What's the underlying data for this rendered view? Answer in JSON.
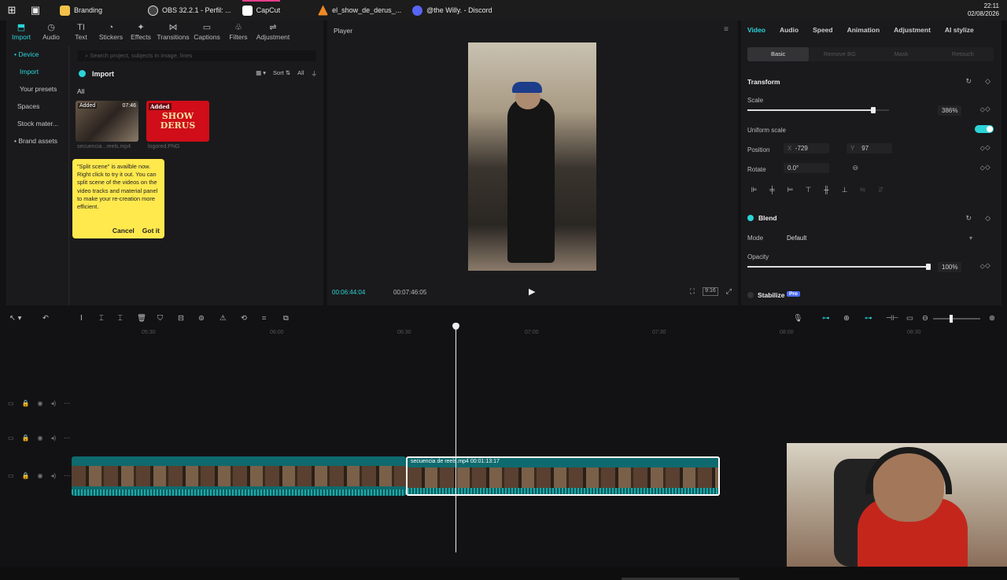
{
  "taskbar": {
    "tasks": [
      {
        "label": "Branding",
        "color": "#f2c14b"
      },
      {
        "label": "OBS 32.2.1 - Perfil: ...",
        "color": "#444444"
      },
      {
        "label": "CapCut",
        "color": "#ffffff"
      },
      {
        "label": "el_show_de_derus_...",
        "color": "#f08a24"
      },
      {
        "label": "@the Willy. - Discord",
        "color": "#5865f2"
      }
    ],
    "time": "22:11",
    "date": "02/08/2026"
  },
  "toolbar": {
    "import": "Import",
    "audio": "Audio",
    "text": "Text",
    "stickers": "Stickers",
    "effects": "Effects",
    "transitions": "Transitions",
    "captions": "Captions",
    "filters": "Filters",
    "adjustment": "Adjustment"
  },
  "sidenav": {
    "device": "• Device",
    "import": "Import",
    "presets": "Your presets",
    "spaces": "Spaces",
    "stock": "Stock mater...",
    "brand": "• Brand assets"
  },
  "media": {
    "search_placeholder": "Search project, subjects in image, lines",
    "import_label": "Import",
    "sort": "Sort",
    "all_filter": "All",
    "all_label": "All",
    "items": [
      {
        "tag": "Added",
        "duration": "07:46",
        "name": "secuencia...reels.mp4"
      },
      {
        "tag": "Added",
        "duration": "",
        "name": "logored.PNG",
        "art": "SHOW DERUS"
      }
    ]
  },
  "tooltip": {
    "text": "\"Split scene\" is availble now. Right click to try it out. You can split scene of the videos on the video tracks and material panel to make your re-creation more efficient.",
    "cancel": "Cancel",
    "ok": "Got it"
  },
  "player": {
    "title": "Player",
    "current_time": "00:06:44:04",
    "total_time": "00:07:46:05",
    "ratio": "9:16"
  },
  "props": {
    "tabs": [
      "Video",
      "Audio",
      "Speed",
      "Animation",
      "Adjustment",
      "AI stylize"
    ],
    "subtabs": [
      "Basic",
      "Remove BG",
      "Mask",
      "Retouch"
    ],
    "transform": "Transform",
    "scale_label": "Scale",
    "scale_value": "386%",
    "scale_level": 0.89,
    "uniform_label": "Uniform scale",
    "position_label": "Position",
    "pos_x_prefix": "X",
    "pos_x": "-729",
    "pos_y_prefix": "Y",
    "pos_y": "97",
    "rotate_label": "Rotate",
    "rotate_value": "0.0°",
    "blend": "Blend",
    "mode_label": "Mode",
    "mode_value": "Default",
    "opacity_label": "Opacity",
    "opacity_value": "100%",
    "opacity_level": 1.0,
    "stabilize": "Stabilize",
    "pro": "Pro"
  },
  "timeline": {
    "ruler": [
      "05:30",
      "06:00",
      "06:30",
      "07:00",
      "07:30",
      "08:00",
      "08:30"
    ],
    "clip_label": "secuencia de reels.mp4   00:01:13:17",
    "zoom_level": 0.35
  }
}
